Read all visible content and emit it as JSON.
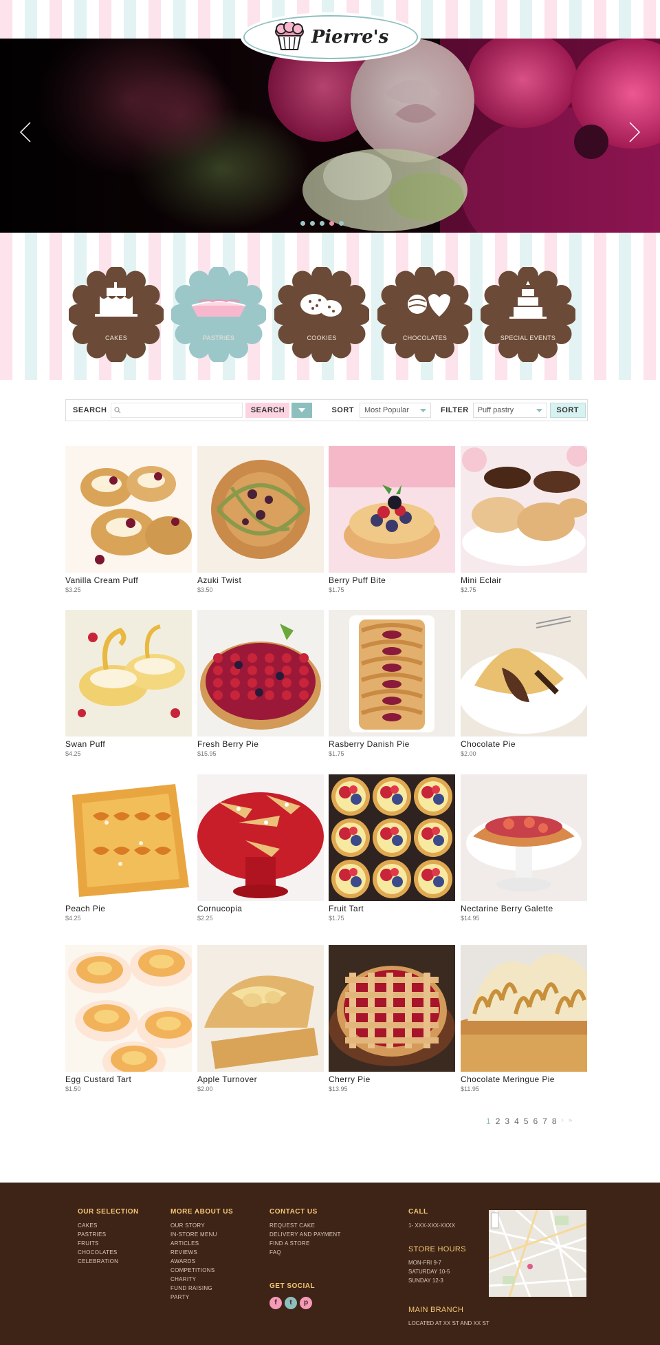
{
  "brand": {
    "name": "Pierre's"
  },
  "hero": {
    "slide_count": 5,
    "active_slide": 4
  },
  "categories": [
    {
      "label": "CAKES",
      "active": false
    },
    {
      "label": "PASTRIES",
      "active": true
    },
    {
      "label": "COOKIES",
      "active": false
    },
    {
      "label": "CHOCOLATES",
      "active": false
    },
    {
      "label": "SPECIAL EVENTS",
      "active": false
    }
  ],
  "colors": {
    "brown": "#6b4a37",
    "teal": "#9cc7c9",
    "pink": "#fbd4e0",
    "footer": "#3e2417",
    "gold": "#f5c774"
  },
  "search": {
    "label": "SEARCH",
    "placeholder": "",
    "button": "SEARCH"
  },
  "sort": {
    "label": "SORT",
    "value": "Most Popular"
  },
  "filter": {
    "label": "FILTER",
    "value": "Puff pastry",
    "button": "SORT"
  },
  "products": [
    {
      "name": "Vanilla Cream Puff",
      "price": "$3.25"
    },
    {
      "name": "Azuki Twist",
      "price": "$3.50"
    },
    {
      "name": "Berry Puff Bite",
      "price": "$1.75"
    },
    {
      "name": "Mini Eclair",
      "price": "$2.75"
    },
    {
      "name": "Swan Puff",
      "price": "$4.25"
    },
    {
      "name": "Fresh Berry Pie",
      "price": "$15.95"
    },
    {
      "name": "Rasberry Danish Pie",
      "price": "$1.75"
    },
    {
      "name": "Chocolate Pie",
      "price": "$2.00"
    },
    {
      "name": "Peach Pie",
      "price": "$4.25"
    },
    {
      "name": "Cornucopia",
      "price": "$2.25"
    },
    {
      "name": "Fruit Tart",
      "price": "$1.75"
    },
    {
      "name": "Nectarine Berry Galette",
      "price": "$14.95"
    },
    {
      "name": "Egg Custard Tart",
      "price": "$1.50"
    },
    {
      "name": "Apple Turnover",
      "price": "$2.00"
    },
    {
      "name": "Cherry Pie",
      "price": "$13.95"
    },
    {
      "name": "Chocolate Meringue Pie",
      "price": "$11.95"
    }
  ],
  "pagination": {
    "pages": [
      "1",
      "2",
      "3",
      "4",
      "5",
      "6",
      "7",
      "8"
    ],
    "current": "1",
    "next": "›",
    "last": "»"
  },
  "footer": {
    "selection": {
      "heading": "OUR SELECTION",
      "links": [
        "CAKES",
        "PASTRIES",
        "FRUITS",
        "CHOCOLATES",
        "CELEBRATION"
      ]
    },
    "more": {
      "heading": "MORE ABOUT US",
      "links": [
        "OUR STORY",
        "IN-STORE MENU",
        "ARTICLES",
        "REVIEWS",
        "AWARDS",
        "COMPETITIONS",
        "CHARITY",
        "FUND RAISING",
        "PARTY"
      ]
    },
    "contact": {
      "heading": "CONTACT US",
      "links": [
        "REQUEST CAKE",
        "DELIVERY AND PAYMENT",
        "FIND A STORE",
        "FAQ"
      ]
    },
    "social": {
      "heading": "GET SOCIAL",
      "icons": [
        "f",
        "t",
        "p"
      ]
    },
    "call": {
      "heading": "CALL",
      "phone": "1- XXX-XXX-XXXX"
    },
    "hours": {
      "heading": "STORE HOURS",
      "lines": [
        "MON-FRI 9-7",
        "SATURDAY 10-5",
        "SUNDAY 12-3"
      ]
    },
    "branch": {
      "heading": "MAIN BRANCH",
      "address": "LOCATED AT XX ST AND XX ST"
    }
  }
}
